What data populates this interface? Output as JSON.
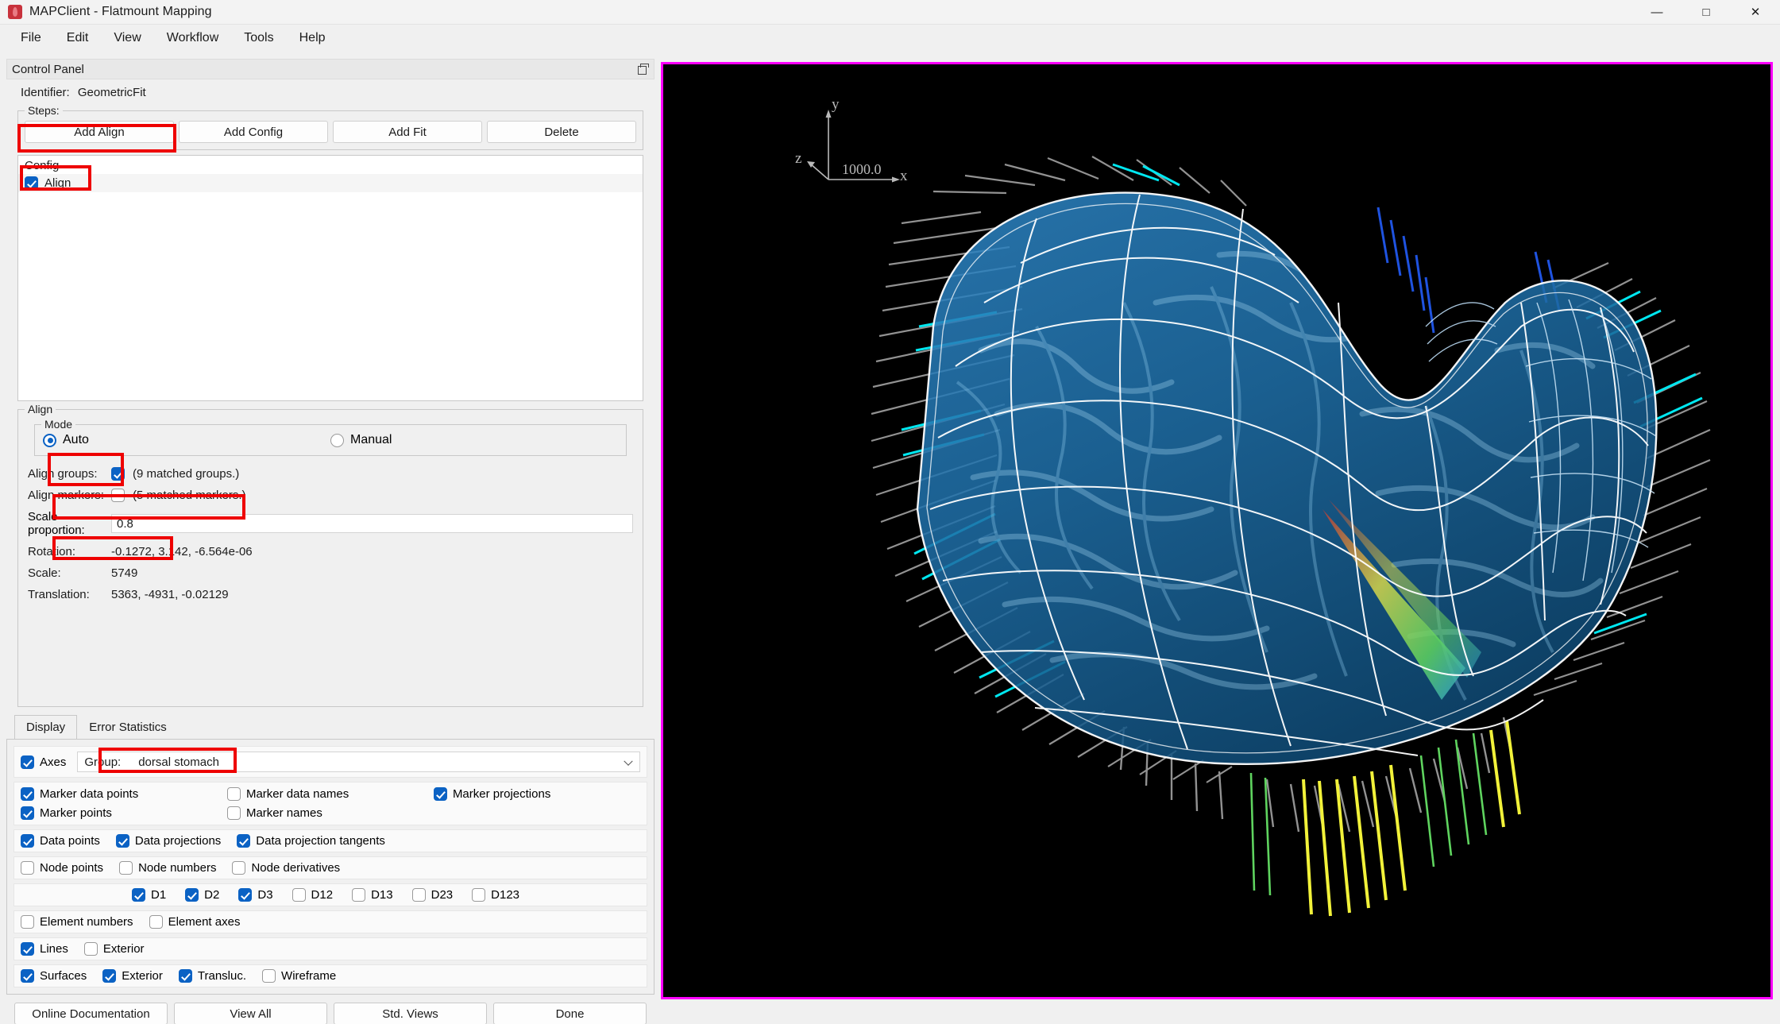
{
  "window": {
    "title": "MAPClient - Flatmount Mapping",
    "app_icon": "mapclient-logo-icon",
    "controls": [
      {
        "name": "minimize-button",
        "glyph": "—"
      },
      {
        "name": "maximize-button",
        "glyph": "□"
      },
      {
        "name": "close-button",
        "glyph": "✕"
      }
    ]
  },
  "menubar": {
    "items": [
      "File",
      "Edit",
      "View",
      "Workflow",
      "Tools",
      "Help"
    ]
  },
  "control_panel": {
    "header_title": "Control Panel",
    "float_icon": "undock-icon",
    "identifier_label": "Identifier:",
    "identifier_value": "GeometricFit",
    "steps": {
      "title": "Steps:",
      "buttons": [
        "Add Align",
        "Add Config",
        "Add Fit",
        "Delete"
      ]
    },
    "config": {
      "label": "Config",
      "items": [
        {
          "label": "Align",
          "checked": true
        }
      ]
    },
    "align": {
      "title": "Align",
      "mode": {
        "title": "Mode",
        "options": [
          {
            "label": "Auto",
            "selected": true
          },
          {
            "label": "Manual",
            "selected": false
          }
        ]
      },
      "align_groups": {
        "label": "Align groups:",
        "checked": true,
        "note": "(9 matched groups.)"
      },
      "align_markers": {
        "label": "Align markers:",
        "checked": false,
        "note": "(5 matched markers.)"
      },
      "scale_proportion": {
        "label": "Scale proportion:",
        "value": "0.8"
      },
      "readouts": [
        {
          "label": "Rotation:",
          "value": "-0.1272, 3.142, -6.564e-06"
        },
        {
          "label": "Scale:",
          "value": "5749"
        },
        {
          "label": "Translation:",
          "value": "5363, -4931, -0.02129"
        }
      ]
    }
  },
  "bottom": {
    "tabs": [
      {
        "label": "Display",
        "active": true
      },
      {
        "label": "Error Statistics",
        "active": false
      }
    ],
    "display": {
      "axes": {
        "label": "Axes",
        "checked": true
      },
      "group": {
        "label": "Group:",
        "value": "dorsal stomach",
        "chevron": "chevron-down-icon"
      },
      "marker_rows": [
        [
          {
            "label": "Marker data points",
            "checked": true
          },
          {
            "label": "Marker data names",
            "checked": false
          },
          {
            "label": "Marker projections",
            "checked": true
          }
        ],
        [
          {
            "label": "Marker points",
            "checked": true
          },
          {
            "label": "Marker names",
            "checked": false
          },
          {
            "label": "",
            "checked": null
          }
        ]
      ],
      "data_row": [
        {
          "label": "Data points",
          "checked": true
        },
        {
          "label": "Data projections",
          "checked": true
        },
        {
          "label": "Data projection tangents",
          "checked": true
        }
      ],
      "node_row": [
        {
          "label": "Node points",
          "checked": false
        },
        {
          "label": "Node numbers",
          "checked": false
        },
        {
          "label": "Node derivatives",
          "checked": false
        }
      ],
      "derivative_row": [
        {
          "label": "D1",
          "checked": true
        },
        {
          "label": "D2",
          "checked": true
        },
        {
          "label": "D3",
          "checked": true
        },
        {
          "label": "D12",
          "checked": false
        },
        {
          "label": "D13",
          "checked": false
        },
        {
          "label": "D23",
          "checked": false
        },
        {
          "label": "D123",
          "checked": false
        }
      ],
      "element_row": [
        {
          "label": "Element numbers",
          "checked": false
        },
        {
          "label": "Element axes",
          "checked": false
        }
      ],
      "lines_row": [
        {
          "label": "Lines",
          "checked": true
        },
        {
          "label": "Exterior",
          "checked": false
        }
      ],
      "surfaces_row": [
        {
          "label": "Surfaces",
          "checked": true
        },
        {
          "label": "Exterior",
          "checked": true
        },
        {
          "label": "Transluc.",
          "checked": true
        },
        {
          "label": "Wireframe",
          "checked": false
        }
      ]
    },
    "footer_buttons": [
      "Online Documentation",
      "View All",
      "Std. Views",
      "Done"
    ]
  },
  "viewport": {
    "background": "#000000",
    "border_color": "#ff00ff",
    "axes": {
      "x_label": "x",
      "y_label": "y",
      "z_label": "z",
      "scale_text": "1000.0"
    },
    "model": {
      "name": "stomach-flatmount-3d-model",
      "surface_color": "#2e7fb5",
      "wireframe_color": "#ffffff",
      "data_point_color": "#9a9a9a",
      "tangent_colors": [
        "#00ffff",
        "#1f4fd8",
        "#ffff00",
        "#39e639",
        "#cc3333"
      ]
    }
  },
  "annotations": {
    "highlight_color": "#ee0000",
    "boxes": [
      "add-align-button",
      "config-align-item",
      "mode-auto-radio",
      "align-groups-field",
      "scale-proportion-field",
      "group-select-field"
    ]
  }
}
